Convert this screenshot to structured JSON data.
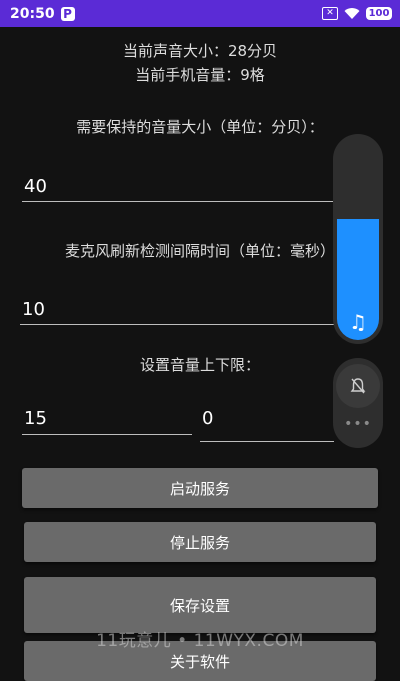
{
  "status_bar": {
    "time": "20:50",
    "app_letter": "P",
    "battery": "100",
    "colors": {
      "background": "#5b2bd6"
    }
  },
  "info": {
    "current_sound": "当前声音大小：28分贝",
    "current_volume": "当前手机音量：9格"
  },
  "keep_volume": {
    "label": "需要保持的音量大小（单位：分贝）：",
    "value": "40"
  },
  "interval": {
    "label": "麦克风刷新检测间隔时间（单位：毫秒）",
    "value": "10"
  },
  "range": {
    "label": "设置音量上下限：",
    "upper": "15",
    "lower": "0"
  },
  "buttons": {
    "start": "启动服务",
    "stop": "停止服务",
    "save": "保存设置",
    "close": "关于软件"
  },
  "volume_overlay": {
    "level_fraction": 0.6,
    "icons": {
      "note": "music-note-icon",
      "ringer": "bell-off-icon",
      "more": "more-dots-icon"
    },
    "colors": {
      "fill": "#1e90ff",
      "panel": "#2e2e2e"
    }
  },
  "watermark": "11玩意儿 • 11WYX.COM"
}
